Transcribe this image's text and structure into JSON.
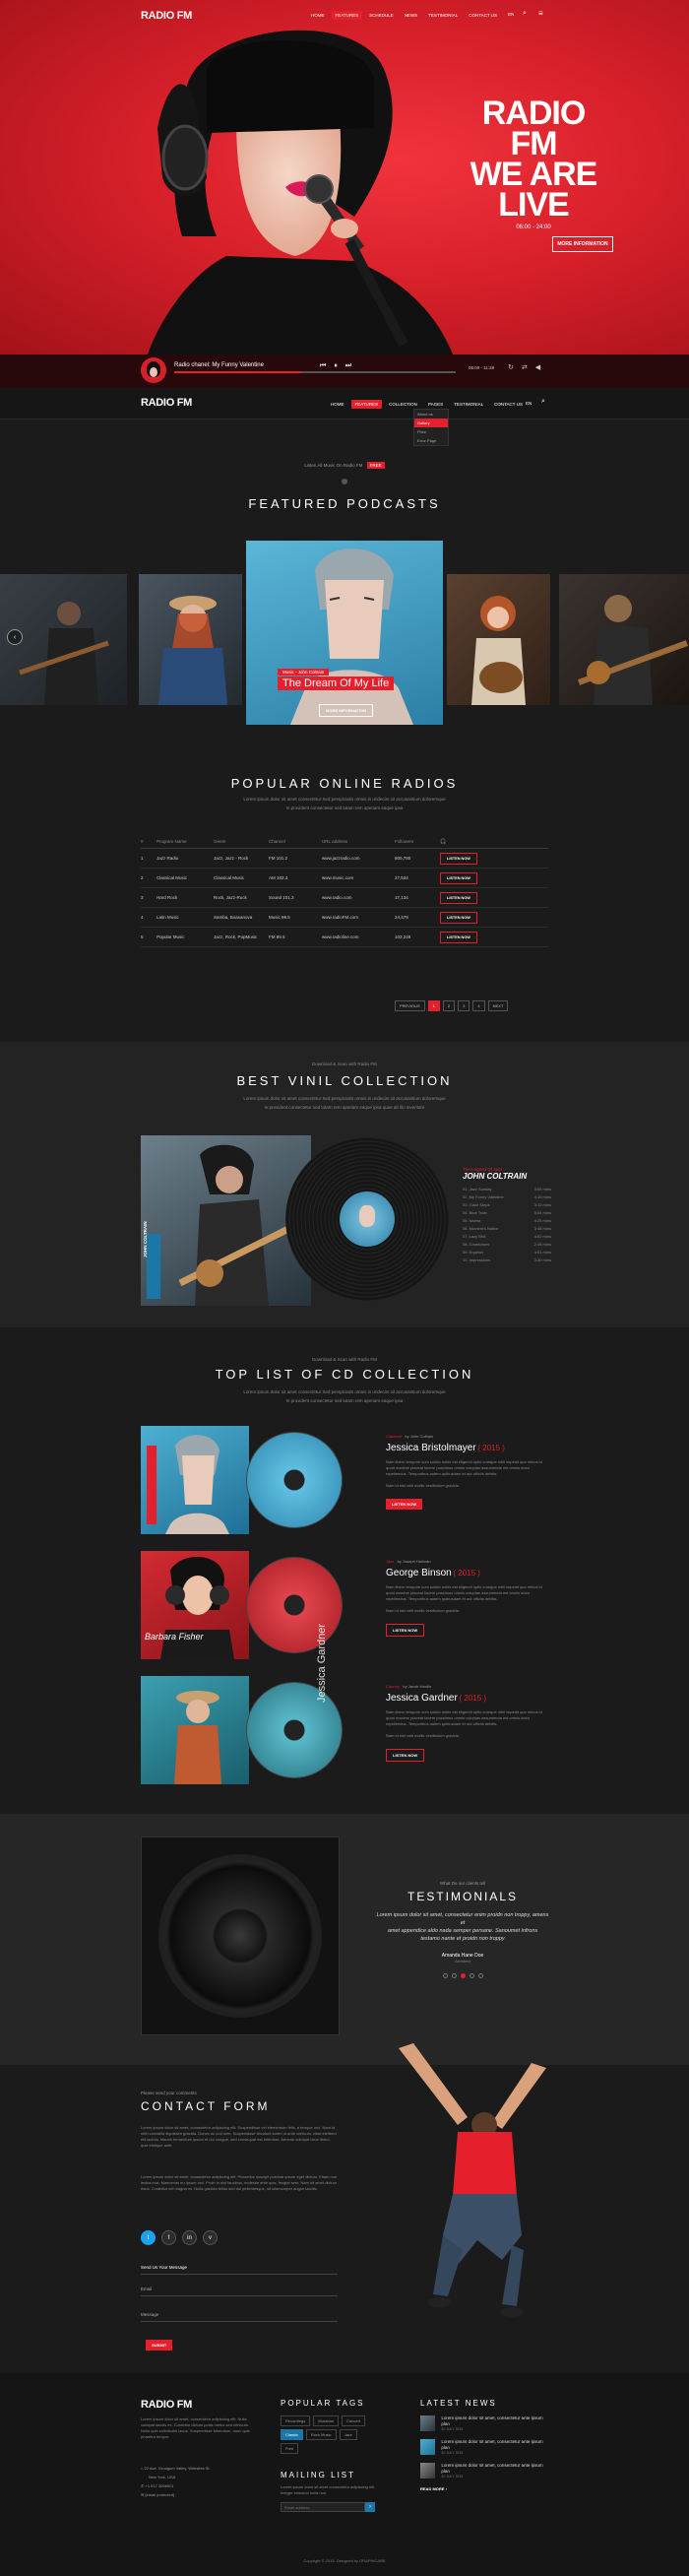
{
  "header": {
    "logo": "RADIO FM",
    "nav": [
      "HOME",
      "FEATURES",
      "SCHEDULE",
      "NEWS",
      "TESTIMONIAL",
      "CONTACT US"
    ],
    "lang": "EN"
  },
  "hero": {
    "title_1": "RADIO FM",
    "title_2": "WE ARE",
    "title_3": "LIVE",
    "hours": "06:00 - 24:00",
    "button": "MORE INFORMATION"
  },
  "player": {
    "track": "Radio chanel: My Funny Valentine",
    "time": "06:00 - 11:28"
  },
  "sticky": {
    "logo": "RADIO FM",
    "nav": [
      "HOME",
      "FEATURES",
      "COLLECTION",
      "PAGES",
      "TESTIMONIAL",
      "CONTACT US"
    ],
    "lang": "EN",
    "dropdown": [
      "About us",
      "Gallery",
      "Price",
      "Error Page"
    ]
  },
  "podcasts": {
    "pre": "Listen All Music On Radio FM",
    "pre_badge": "FREE",
    "title": "FEATURED PODCASTS",
    "artist": "Music - John Coltrain",
    "track": "The Dream Of My Life",
    "button": "MORE INFORMATION"
  },
  "radios": {
    "title": "POPULAR ONLINE RADIOS",
    "sub_1": "Lorem ipsum dolor sit amet consectetur Sed perspiciatis omnis in undecim sit accusantium doloremque",
    "sub_2": "In provident consectetur sed totam rem aperiam eaque ipsa",
    "headers": [
      "#",
      "Program Name",
      "Genre",
      "Channel",
      "URL address",
      "Followers",
      ""
    ],
    "rows": [
      {
        "n": "1",
        "name": "Jazz Radio",
        "genre": "Jazz, Jazz - Rock",
        "channel": "FM 101.2",
        "url": "www.jazzradio.com",
        "followers": "800,780",
        "btn": "LISTEN NOW"
      },
      {
        "n": "2",
        "name": "Classical Music",
        "genre": "Classical Music",
        "channel": "AM 102.3",
        "url": "www.music.com",
        "followers": "27,534",
        "btn": "LISTEN NOW"
      },
      {
        "n": "3",
        "name": "Hard Rock",
        "genre": "Rock, Jazz-Rock",
        "channel": "Sound 101.3",
        "url": "www.radio.com",
        "followers": "17,134",
        "btn": "LISTEN NOW"
      },
      {
        "n": "4",
        "name": "Latin Music",
        "genre": "Samba, Boasanova",
        "channel": "Music 98.5",
        "url": "www.radioFM.com",
        "followers": "24,478",
        "btn": "LISTEN NOW"
      },
      {
        "n": "5",
        "name": "Popular Music",
        "genre": "Jazz, Rock, PopMusic",
        "channel": "FM 89.5",
        "url": "www.radioline.com",
        "followers": "103,249",
        "btn": "LISTEN NOW"
      }
    ],
    "pager": [
      "PREVIOUS",
      "1",
      "2",
      "3",
      "4",
      "NEXT"
    ]
  },
  "vinyl": {
    "pre": "Download & Scan with Radio FM",
    "title": "BEST VINIL COLLECTION",
    "sub_1": "Lorem ipsum dolor sit amet consectetur Sed perspiciatis omnis in undecim sit accusantium doloremque",
    "sub_2": "In provident consectetur sed totam rem aperiam eaque ipsa quae ab illo inventore",
    "cover_text": "JOHN COLTRAIN",
    "label": "The Legend Of Jazz",
    "artist": "JOHN COLTRAIN",
    "tracks": [
      {
        "t": "01. Jazz Sunday",
        "d": "3:55 mins"
      },
      {
        "t": "02. My Funny Valentine",
        "d": "4:10 mins"
      },
      {
        "t": "03. Giant Steps",
        "d": "3:12 mins"
      },
      {
        "t": "04. Blue Train",
        "d": "5:04 mins"
      },
      {
        "t": "05. Naima",
        "d": "4:25 mins"
      },
      {
        "t": "06. Moment's Notice",
        "d": "3:48 mins"
      },
      {
        "t": "07. Lazy Bird",
        "d": "4:02 mins"
      },
      {
        "t": "08. Countdown",
        "d": "2:45 mins"
      },
      {
        "t": "09. Equinox",
        "d": "4:51 mins"
      },
      {
        "t": "10. Impressions",
        "d": "3:30 mins"
      }
    ]
  },
  "cds": {
    "pre": "Download & Scan with Radio FM",
    "title": "TOP LIST OF CD COLLECTION",
    "sub_1": "Lorem ipsum dolor sit amet consectetur Sed perspiciatis omnis in undecim sit accusantium doloremque",
    "sub_2": "In provident consectetur sed totam rem aperiam eaque ipsa",
    "items": [
      {
        "tag": "Classical",
        "by": "by John Coltrain",
        "name": "Jessica Bristolmayer",
        "year": "( 2015 )",
        "text": "Nam libero tempore cum soluta nobis est eligendi optio cumque nihil impedit quo minus id quod maxime placeat facere possimus omnis voluptas assumenda est omnis dolor repellendus. Temporibus autem quibusdam et aut officiis debitis.",
        "text2": "Nam id nisl velit mollis vestibulum gravida.",
        "btn": "LISTEN NOW",
        "cover": "Jessica Bristolmayer"
      },
      {
        "tag": "Jazz",
        "by": "by Joseph Hallman",
        "name": "George Binson",
        "year": "( 2015 )",
        "text": "Nam libero tempore cum soluta nobis est eligendi optio cumque nihil impedit quo minus id quod maxime placeat facere possimus omnis voluptas assumenda est omnis dolor repellendus. Temporibus autem quibusdam et aut officiis debitis.",
        "text2": "Nam id nisl velit mollis vestibulum gravida.",
        "btn": "LISTEN NOW",
        "cover": "Barbara Fisher"
      },
      {
        "tag": "Country",
        "by": "by Jacob Hardin",
        "name": "Jessica Gardner",
        "year": "( 2015 )",
        "text": "Nam libero tempore cum soluta nobis est eligendi optio cumque nihil impedit quo minus id quod maxime placeat facere possimus omnis voluptas assumenda est omnis dolor repellendus. Temporibus autem quibusdam et aut officiis debitis.",
        "text2": "Nam id nisl velit mollis vestibulum gravida.",
        "btn": "LISTEN NOW",
        "cover": "Jessica Gardner"
      }
    ]
  },
  "testimonials": {
    "pre": "What Do our clients tell",
    "title": "TESTIMONIALS",
    "quote_1": "Lorem ipsum dolor sit amet, consectetur enim proidn non troppy, amens et",
    "quote_2": "amet appendice aldo nada semper persane. Sanoumet infrons",
    "quote_3": "testamo nante et proidn non troppy",
    "author": "Amanda Hane Doe",
    "role": "Architect"
  },
  "contact": {
    "pre": "Please send your comments",
    "title": "CONTACT FORM",
    "p1": "Lorem ipsum dolor sit amet, consectetur adipiscing elit. Suspendisse vel elementum felis, a tempor orci. Nam id nibh convallis dignissim gravida. Donec ac orci sem. Suspendisse tincidunt lorem ut ante vehicula, vitae eleifend elit lacinia. Mauris fermentum ipsum et dui congue, sed consequat est interdum. Aenean volutpat risus libero, quis tristique ante.",
    "p2": "Lorem ipsum dolor sit amet, consectetur adipiscing elit. Phasellus suscipit pulvinar ipsum eget dictum. Etiam non lectus erat. Maecenas eu ipsum orci. Proin in nisl faucibus, molestie ante quis, feugiat sem. Nam sit amet dictum risus. Curabitur vel magna mi. Nulla gravida tellus sed dui pellentesque, sit ullamcorper augue iaculis.",
    "socials": [
      "t",
      "f",
      "in",
      "v"
    ],
    "send_label": "Send Us Your Message",
    "email_label": "Email",
    "message_label": "Message",
    "submit": "SUBMIT"
  },
  "footer": {
    "logo": "RADIO FM",
    "about": "Lorem ipsum dolor sit amet, consectetur adipiscing elit. Nulla volutpat iaculis ex. Curabitur dictum porta metus sed vehicula. Nulla quis sollicitudin lacus. Suspendisse bibendum, nunc quis pharetra tempor.",
    "address_1": "22 Ave. Grodgum Valley, Websites St.",
    "address_2": "New York, USA",
    "phone": "+1 917 3098901",
    "email": "[email protected]",
    "tags_title": "POPULAR TAGS",
    "tags": [
      "Recordings",
      "Musician",
      "Concert",
      "Classic",
      "Rock Music",
      "Jazz",
      "Free"
    ],
    "mailing_title": "MAILING LIST",
    "mailing_text": "Lorem ipsum dolor sit amet consectetur adipiscing elit. Integer euismod nulla non.",
    "mailing_placeholder": "Email address",
    "news_title": "LATEST NEWS",
    "news": [
      {
        "t": "Lorem ipsum dolor sit amet, consectetur ante ipsum plan",
        "d": "20 JULY 2015"
      },
      {
        "t": "Lorem ipsum dolor sit amet, consectetur ante ipsum plan",
        "d": "20 JULY 2015"
      },
      {
        "t": "Lorem ipsum dolor sit amet, consectetur ante ipsum plan",
        "d": "20 JULY 2015"
      }
    ],
    "read_more": "READ MORE",
    "copyright": "Copyright © 2015. Designed by GRAPHICARE"
  },
  "colors": {
    "accent": "#e5202c",
    "background": "#1b1b1b",
    "panel": "#232323"
  }
}
